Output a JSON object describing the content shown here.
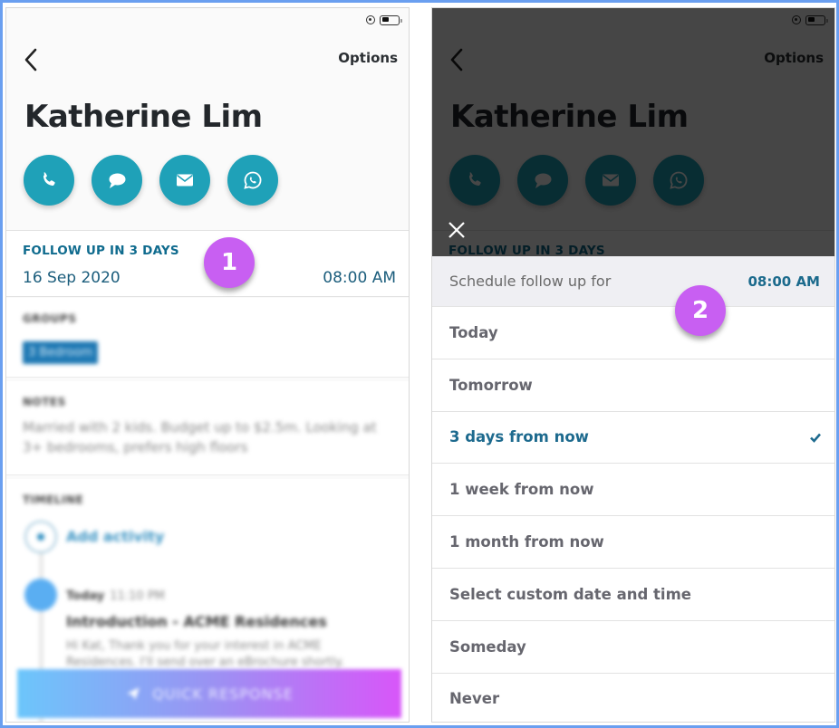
{
  "status_bar": {
    "icons": [
      "rotation-lock-icon",
      "battery-icon"
    ]
  },
  "contact": {
    "name": "Katherine Lim",
    "back_icon": "chevron-left-icon",
    "options_label": "Options",
    "actions": [
      {
        "name": "call",
        "icon": "phone-icon"
      },
      {
        "name": "message",
        "icon": "chat-bubble-icon"
      },
      {
        "name": "email",
        "icon": "envelope-icon"
      },
      {
        "name": "whatsapp",
        "icon": "whatsapp-icon"
      }
    ],
    "accent_color": "#1fa1b8"
  },
  "followup": {
    "label": "FOLLOW UP IN  3 DAYS",
    "date": "16 Sep 2020",
    "time": "08:00 AM"
  },
  "groups": {
    "title": "GROUPS",
    "chips": [
      "3 Bedroom"
    ]
  },
  "notes": {
    "title": "NOTES",
    "text": "Married with 2 kids. Budget up to $2.5m. Looking at 3+ bedrooms, prefers high floors"
  },
  "timeline": {
    "title": "TIMELINE",
    "add_label": "Add activity",
    "entries": [
      {
        "day": "Today",
        "time": "11:10 PM",
        "title": "Introduction - ACME Residences",
        "body": "Hi Kat, Thank you for your interest in ACME Residences. I'll send over an eBrochure shortly."
      }
    ]
  },
  "quick_response": {
    "label": "QUICK RESPONSE",
    "icon": "send-icon"
  },
  "annotations": {
    "badge_1": "1",
    "badge_2": "2",
    "color": "#c85ff2"
  },
  "sheet": {
    "title": "Schedule follow up for",
    "time": "08:00 AM",
    "close_icon": "close-icon",
    "options": [
      {
        "label": "Today",
        "selected": false
      },
      {
        "label": "Tomorrow",
        "selected": false
      },
      {
        "label": "3 days from now",
        "selected": true
      },
      {
        "label": "1 week from now",
        "selected": false
      },
      {
        "label": "1 month from now",
        "selected": false
      },
      {
        "label": "Select custom date and time",
        "selected": false
      },
      {
        "label": "Someday",
        "selected": false
      },
      {
        "label": "Never",
        "selected": false
      }
    ]
  }
}
